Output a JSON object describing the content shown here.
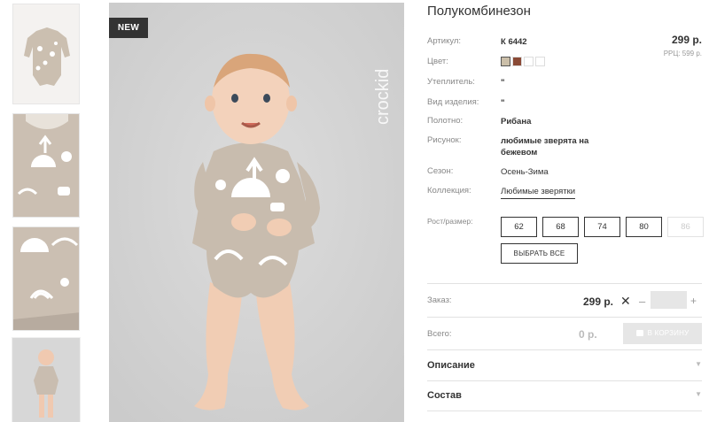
{
  "gallery": {
    "badge": "NEW",
    "brand_text": "crockid",
    "thumbnails": [
      "thumb-front",
      "thumb-pattern-top",
      "thumb-pattern-bottom",
      "thumb-child"
    ]
  },
  "product": {
    "title": "Полукомбинезон",
    "price": "299 р.",
    "rrp": "РРЦ: 599 р.",
    "attributes": [
      {
        "label": "Артикул:",
        "value": "К 6442"
      },
      {
        "label": "Цвет:",
        "value": ""
      },
      {
        "label": "Утеплитель:",
        "value": "\""
      },
      {
        "label": "Вид изделия:",
        "value": "\""
      },
      {
        "label": "Полотно:",
        "value": "Рибана"
      },
      {
        "label": "Рисунок:",
        "value": "любимые зверята на бежевом"
      },
      {
        "label": "Сезон:",
        "value": "Осень-Зима"
      },
      {
        "label": "Коллекция:",
        "value": "Любимые зверятки"
      }
    ],
    "colors": [
      {
        "hex": "#cbbfa9",
        "selected": true
      },
      {
        "hex": "#8a4a36",
        "selected": false
      },
      {
        "hex": "#ffffff",
        "selected": false
      },
      {
        "hex": "#ffffff",
        "selected": false
      }
    ]
  },
  "sizes": {
    "label": "Рост/размер:",
    "options": [
      {
        "value": "62",
        "disabled": false
      },
      {
        "value": "68",
        "disabled": false
      },
      {
        "value": "74",
        "disabled": false
      },
      {
        "value": "80",
        "disabled": false
      },
      {
        "value": "86",
        "disabled": true
      }
    ],
    "select_all": "ВЫБРАТЬ ВСЕ"
  },
  "order": {
    "label": "Заказ:",
    "price": "299 р.",
    "remove": "✕",
    "minus": "–",
    "plus": "+",
    "quantity": ""
  },
  "total": {
    "label": "Всего:",
    "value": "0 р.",
    "cart_button": "В КОРЗИНУ"
  },
  "accordion": [
    {
      "label": "Описание",
      "arrow": "▼"
    },
    {
      "label": "Состав",
      "arrow": "▼"
    }
  ],
  "colors": {
    "text": "#333333",
    "muted": "#888888",
    "badge_bg": "#333333",
    "photo_bg": "#d4d4d4",
    "garment": "#c8bcae"
  }
}
